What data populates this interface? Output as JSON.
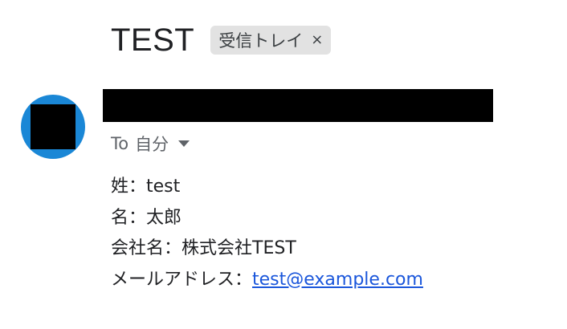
{
  "email": {
    "subject": "TEST",
    "label": {
      "text": "受信トレイ",
      "close_glyph": "×"
    },
    "avatar": {
      "color": "#1a87d6"
    },
    "recipient": {
      "to_label": "To",
      "name": "自分"
    },
    "body": {
      "last_name_label": "姓：",
      "last_name_value": "test",
      "first_name_label": "名：",
      "first_name_value": "太郎",
      "company_label": "会社名：",
      "company_value": "株式会社TEST",
      "email_label": "メールアドレス：",
      "email_value": "test@example.com"
    },
    "colors": {
      "link": "#1a56db",
      "chip_bg": "#e2e2e2"
    }
  }
}
